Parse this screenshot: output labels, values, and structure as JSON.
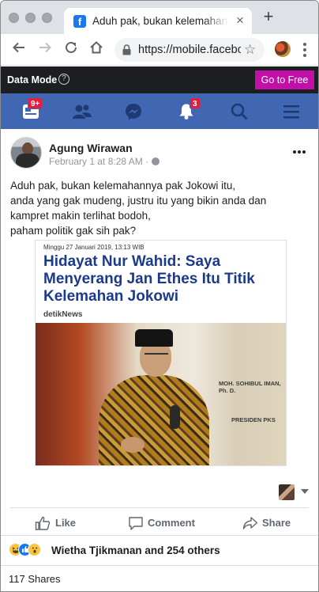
{
  "browser": {
    "tab_title": "Aduh pak, bukan kelemahannya pak Jokowi itu,",
    "tab_close": "×",
    "new_tab": "+",
    "url": "https://mobile.facebook.com",
    "star": "☆"
  },
  "data_mode": {
    "label": "Data Mode",
    "help": "?",
    "button": "Go to Free"
  },
  "nav": {
    "feed_badge": "9+",
    "notifications_badge": "3",
    "accent_color": "#4267b2"
  },
  "post": {
    "author": "Agung Wirawan",
    "timestamp": "February 1 at 8:28 AM ·",
    "text_lines": [
      "Aduh pak, bukan kelemahannya pak Jokowi itu,",
      "anda yang gak mudeng, justru itu yang bikin anda dan",
      "kampret makin terlihat bodoh,",
      "paham politik gak sih pak?"
    ],
    "shared_image": {
      "date": "Minggu 27 Januari 2019, 13:13 WIB",
      "headline_lines": [
        "Hidayat Nur Wahid: Saya",
        "Menyerang Jan Ethes Itu Titik",
        "Kelemahan Jokowi"
      ],
      "source": "detikNews",
      "photo_text_1": "MOH. SOHIBUL IMAN, Ph. D.",
      "photo_text_2": "PRESIDEN PKS"
    },
    "actions": {
      "like": "Like",
      "comment": "Comment",
      "share": "Share"
    },
    "reactions_text": "Wietha Tjikmanan and 254 others",
    "shares": "117 Shares"
  }
}
